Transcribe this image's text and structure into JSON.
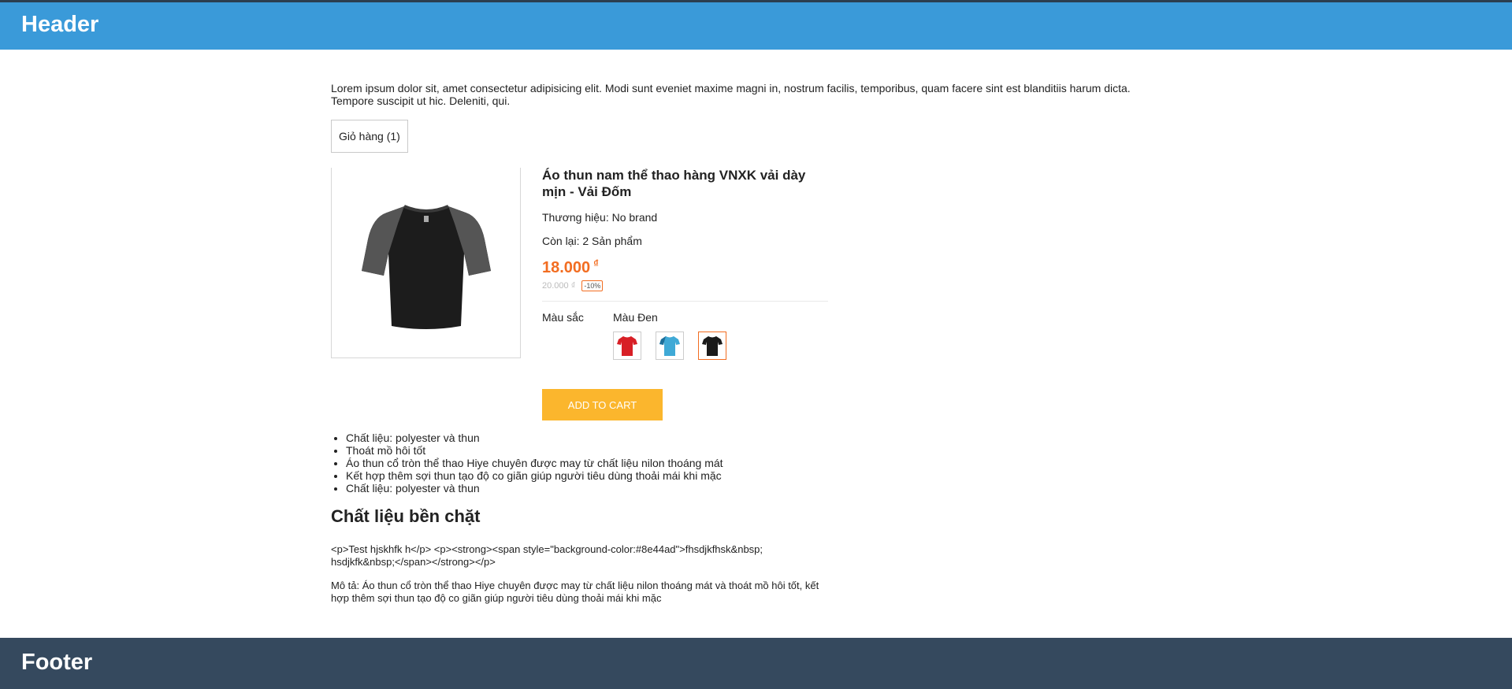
{
  "header": {
    "title": "Header"
  },
  "footer": {
    "title": "Footer"
  },
  "intro": "Lorem ipsum dolor sit, amet consectetur adipisicing elit. Modi sunt eveniet maxime magni in, nostrum facilis, temporibus, quam facere sint est blanditiis harum dicta. Tempore suscipit ut hic. Deleniti, qui.",
  "cart": {
    "label": "Giỏ hàng (1)"
  },
  "product": {
    "title": "Áo thun nam thể thao hàng VNXK vải dày mịn - Vải Đốm",
    "brand": "Thương hiệu: No brand",
    "stock": "Còn lại: 2 Sản phẩm",
    "price": "18.000",
    "currency": "₫",
    "old_price": "20.000 ₫",
    "discount": "-10%",
    "color_label": "Màu sắc",
    "color_value": "Màu Đen",
    "swatches": [
      {
        "name": "red",
        "color": "#d81f26"
      },
      {
        "name": "blue",
        "color": "#3fa9d6"
      },
      {
        "name": "black",
        "color": "#1a1a1a"
      }
    ],
    "add_to_cart": "ADD TO CART"
  },
  "features": [
    "Chất liệu: polyester và thun",
    "Thoát mồ hôi tốt",
    "Áo thun cổ tròn thể thao Hiye chuyên được may từ chất liệu nilon thoáng mát",
    "Kết hợp thêm sợi thun tạo độ co giãn giúp người tiêu dùng thoải mái khi mặc",
    "Chất liệu: polyester và thun"
  ],
  "section_title": "Chất liệu bền chặt",
  "raw_html_text": "<p>Test hjskhfk h</p> <p><strong><span style=\"background-color:#8e44ad\">fhsdjkfhsk&nbsp; hsdjkfk&nbsp;</span></strong></p>",
  "description": "Mô tả: Áo thun cổ tròn thể thao Hiye chuyên được may từ chất liệu nilon thoáng mát và thoát mồ hôi tốt, kết hợp thêm sợi thun tạo độ co giãn giúp người tiêu dùng thoải mái khi mặc"
}
